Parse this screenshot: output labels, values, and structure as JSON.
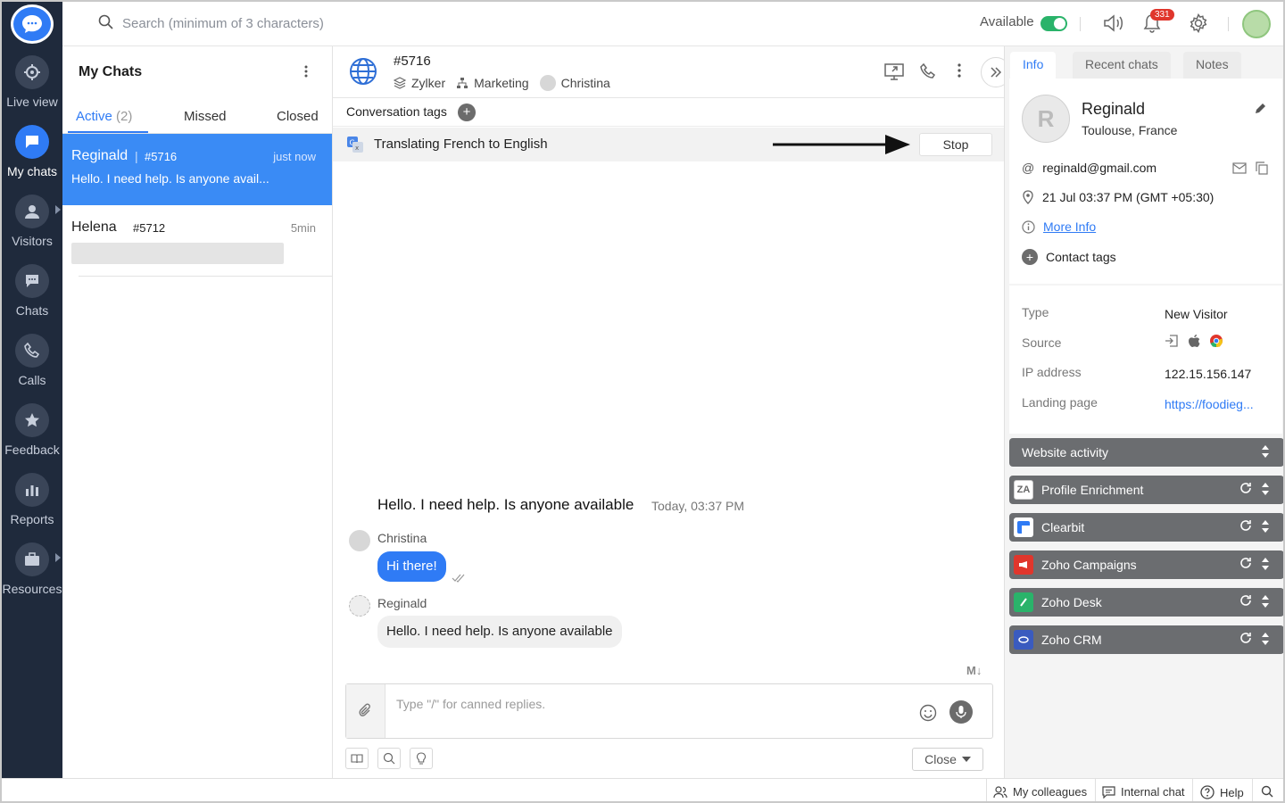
{
  "search": {
    "placeholder": "Search (minimum of 3 characters)"
  },
  "topbar": {
    "availability": "Available",
    "notification_count": "331"
  },
  "rail": {
    "items": [
      {
        "label": "Live view",
        "icon": "crosshair-icon"
      },
      {
        "label": "My chats",
        "icon": "chat-bubble-icon",
        "active": true
      },
      {
        "label": "Visitors",
        "icon": "person-icon"
      },
      {
        "label": "Chats",
        "icon": "chat-icon"
      },
      {
        "label": "Calls",
        "icon": "phone-icon"
      },
      {
        "label": "Feedback",
        "icon": "star-icon"
      },
      {
        "label": "Reports",
        "icon": "bar-chart-icon"
      },
      {
        "label": "Resources",
        "icon": "briefcase-icon"
      }
    ]
  },
  "list": {
    "title": "My Chats",
    "tabs": [
      {
        "label": "Active",
        "count": "(2)"
      },
      {
        "label": "Missed"
      },
      {
        "label": "Closed"
      }
    ],
    "chats": [
      {
        "name": "Reginald",
        "id": "#5716",
        "time": "just now",
        "message": "Hello. I need help. Is anyone avail..."
      },
      {
        "name": "Helena",
        "id": "#5712",
        "time": "5min",
        "message": ""
      }
    ]
  },
  "conversation": {
    "id": "#5716",
    "brand": "Zylker",
    "department": "Marketing",
    "agent": "Christina",
    "tags_label": "Conversation tags",
    "translation_text": "Translating French to English",
    "stop_label": "Stop",
    "messages": [
      {
        "sender": "Reginald",
        "text": "Hello. I need help. Is anyone available",
        "time": "Today, 03:37 PM"
      },
      {
        "sender": "Christina",
        "text": "Hi there!"
      },
      {
        "sender": "Reginald",
        "text": "Hello. I need help. Is anyone available"
      }
    ],
    "composer_placeholder": "Type \"/\" for canned replies.",
    "close_label": "Close",
    "markdown_badge": "M↓"
  },
  "right_panel": {
    "tabs": [
      "Info",
      "Recent chats",
      "Notes"
    ],
    "visitor": {
      "name": "Reginald",
      "location": "Toulouse, France",
      "email": "reginald@gmail.com",
      "datetime": "21 Jul 03:37 PM  (GMT +05:30)",
      "more_info": "More Info",
      "contact_tags": "Contact tags"
    },
    "details": [
      {
        "label": "Type",
        "value": "New Visitor"
      },
      {
        "label": "Source",
        "value": ""
      },
      {
        "label": "IP address",
        "value": "122.15.156.147"
      },
      {
        "label": "Landing page",
        "value": "https://foodieg..."
      }
    ],
    "sections": [
      {
        "label": "Website activity",
        "logo": ""
      },
      {
        "label": "Profile Enrichment",
        "logo": "ZA",
        "color": "#ffffff"
      },
      {
        "label": "Clearbit",
        "logo": "C",
        "color": "#2f7bf5"
      },
      {
        "label": "Zoho Campaigns",
        "logo": "Z",
        "color": "#e0362c"
      },
      {
        "label": "Zoho Desk",
        "logo": "D",
        "color": "#2ab36a"
      },
      {
        "label": "Zoho CRM",
        "logo": "C",
        "color": "#3a5bbf"
      }
    ]
  },
  "statusbar": {
    "colleagues": "My colleagues",
    "internal_chat": "Internal chat",
    "help": "Help"
  }
}
